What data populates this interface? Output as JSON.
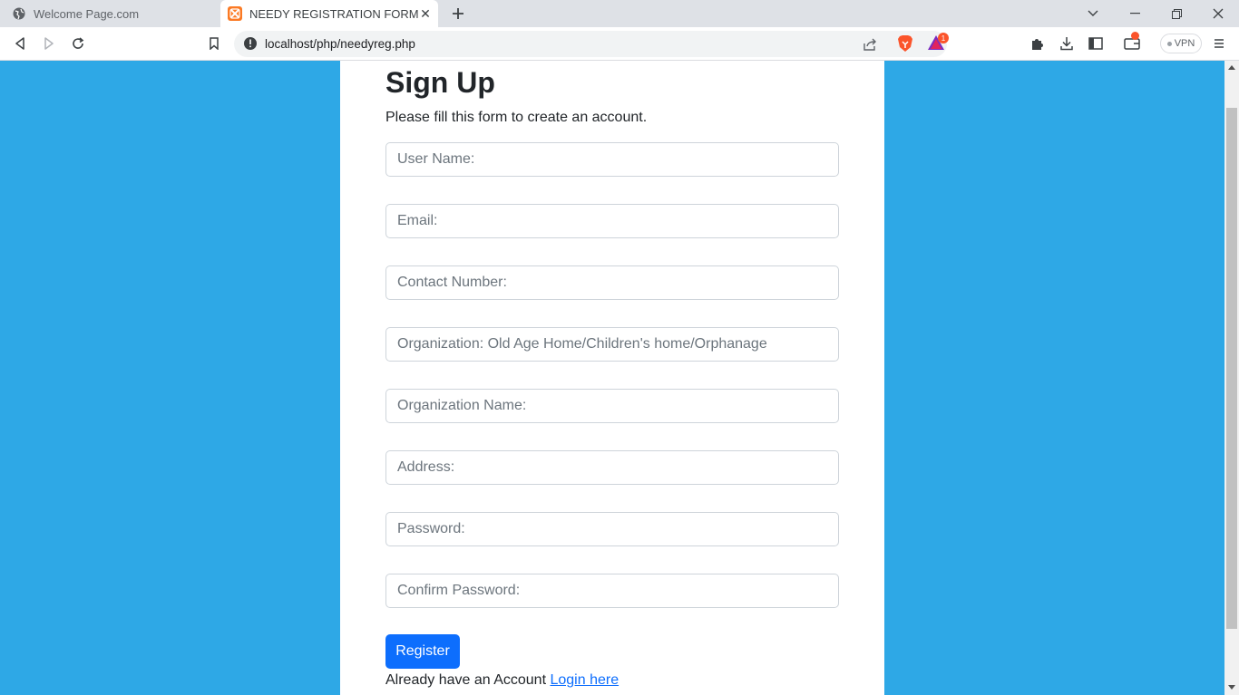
{
  "browser": {
    "tabs": [
      {
        "title": "Welcome Page.com",
        "active": false
      },
      {
        "title": "NEEDY REGISTRATION FORM",
        "active": true
      }
    ],
    "url": "localhost/php/needyreg.php",
    "vpn_label": "VPN",
    "rewards_badge": "1"
  },
  "form": {
    "title": "Sign Up",
    "subtitle": "Please fill this form to create an account.",
    "fields": [
      {
        "placeholder": "User Name:"
      },
      {
        "placeholder": "Email:"
      },
      {
        "placeholder": "Contact Number:"
      },
      {
        "placeholder": "Organization: Old Age Home/Children's home/Orphanage"
      },
      {
        "placeholder": "Organization Name:"
      },
      {
        "placeholder": "Address:"
      },
      {
        "placeholder": "Password:"
      },
      {
        "placeholder": "Confirm Password:"
      }
    ],
    "submit_label": "Register",
    "footer_text": "Already have an Account",
    "footer_link": "Login here"
  },
  "colors": {
    "page_background": "#2ea8e6",
    "primary_button": "#0d6efd"
  }
}
